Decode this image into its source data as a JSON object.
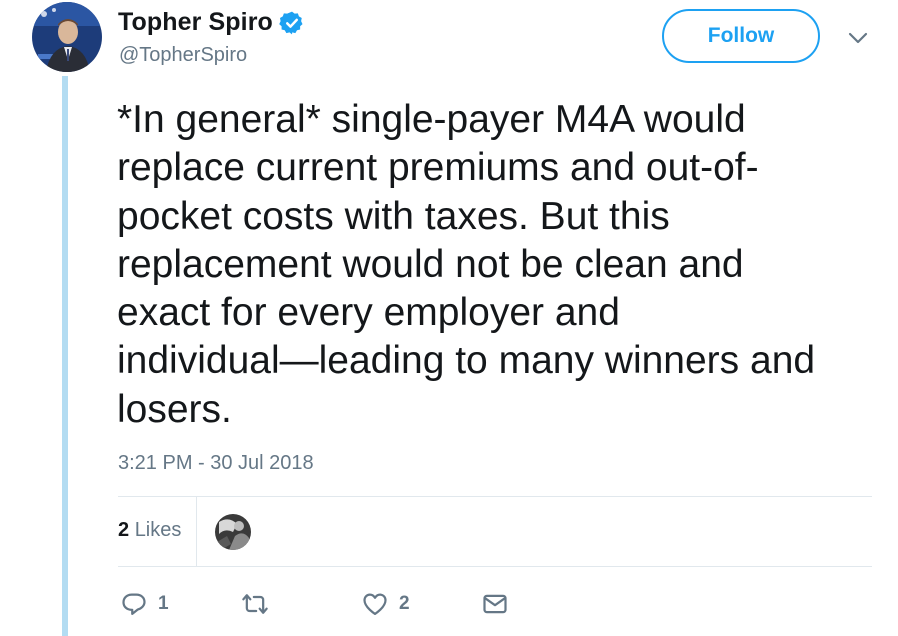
{
  "author": {
    "display_name": "Topher Spiro",
    "handle": "@TopherSpiro",
    "verified": true
  },
  "follow_label": "Follow",
  "tweet": {
    "text": "*In general* single-payer M4A would\nreplace current premiums and out-of-\npocket costs with taxes. But this\nreplacement would not be clean and\nexact for every employer and\nindividual—leading to many winners and\nlosers.",
    "timestamp": "3:21 PM - 30 Jul 2018"
  },
  "stats": {
    "likes_count": "2",
    "likes_label": "Likes"
  },
  "actions": {
    "reply_count": "1",
    "retweet_count": "",
    "like_count": "2"
  },
  "colors": {
    "accent": "#1da1f2",
    "muted": "#657786",
    "thread_line": "#b3dcf2",
    "divider": "#e1e8ed"
  },
  "icons": {
    "verified": "verified-badge-icon",
    "caret": "chevron-down-icon",
    "reply": "reply-icon",
    "retweet": "retweet-icon",
    "like": "heart-icon",
    "dm": "envelope-icon"
  }
}
